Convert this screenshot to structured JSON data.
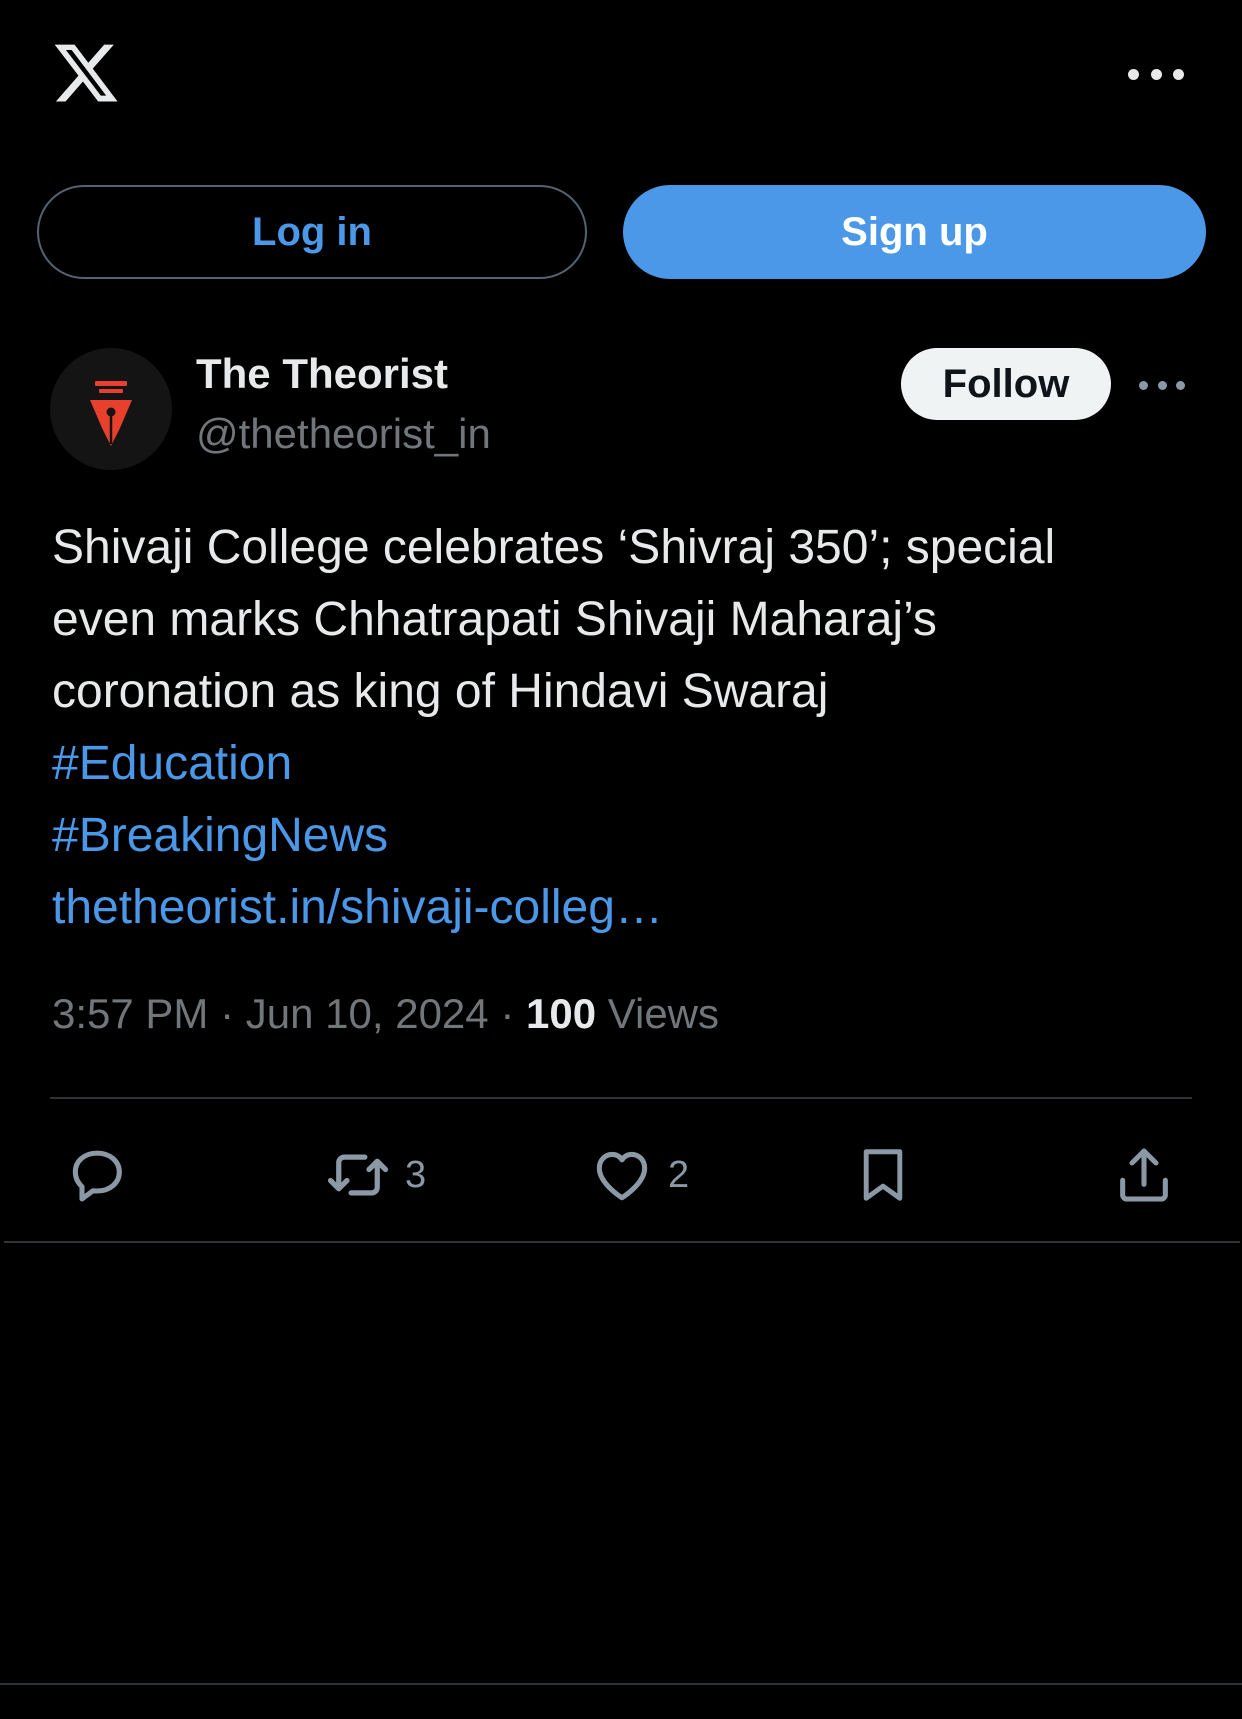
{
  "topbar": {
    "logo_icon": "x-logo-icon",
    "more_icon": "more-horizontal-icon"
  },
  "auth": {
    "login_label": "Log in",
    "signup_label": "Sign up"
  },
  "post": {
    "avatar_icon": "fountain-pen-nib-icon",
    "display_name": "The Theorist",
    "handle": "@thetheorist_in",
    "follow_label": "Follow",
    "more_icon": "more-horizontal-icon",
    "text_lines": [
      "Shivaji College celebrates ‘Shivraj 350’; special",
      "even marks Chhatrapati Shivaji Maharaj’s",
      "coronation as king of Hindavi Swaraj"
    ],
    "hashtags": [
      "#Education",
      "#BreakingNews"
    ],
    "link_text": "thetheorist.in/shivaji-colleg…",
    "time": "3:57 PM",
    "separator": "·",
    "date": "Jun 10, 2024",
    "views_count": "100",
    "views_label": "Views"
  },
  "actions": {
    "reply_icon": "reply-icon",
    "repost_icon": "repost-icon",
    "repost_count": "3",
    "like_icon": "heart-icon",
    "like_count": "2",
    "bookmark_icon": "bookmark-icon",
    "share_icon": "share-icon"
  },
  "colors": {
    "background": "#000000",
    "accent": "#4a98e7",
    "text_primary": "#e7e9ea",
    "text_secondary": "#71767b",
    "divider": "#2f3336",
    "avatar_red": "#e8402c"
  }
}
